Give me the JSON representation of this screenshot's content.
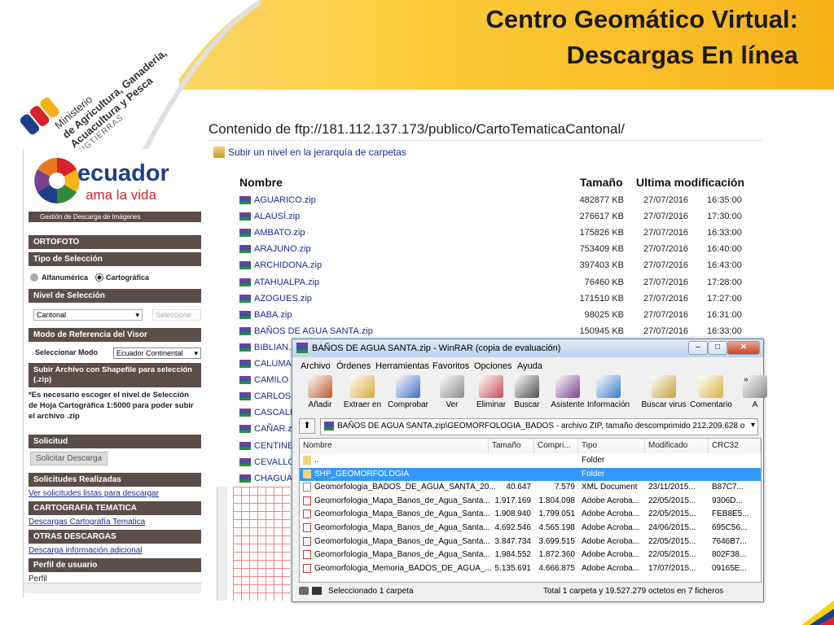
{
  "slide": {
    "title_line1": "Centro Geomático Virtual:",
    "title_line2": "Descargas En línea",
    "ministry": {
      "line1": "Ministerio",
      "line2": "de Agricultura, Ganadería,",
      "line3": "Acuacultura y Pesca",
      "line4": "SIGTIERRAS"
    },
    "colors": {
      "accent_yellow": "#f7b21a",
      "portal_bar": "#5b4d4a",
      "link_blue": "#1a2c8e",
      "selection_blue": "#3399ff"
    }
  },
  "portal": {
    "logo_word": "ecuador",
    "logo_sub": "ama la vida",
    "header_bar": "Gestión de Descarga de Imágenes",
    "ortofoto": "ORTOFOTO",
    "tipo_seleccion": "Tipo de Selección",
    "radio_alfanumerica": "Alfanumérica",
    "radio_cartografica": "Cartográfica",
    "nivel_seleccion": "Nivel de Selección",
    "nivel_value": "Cantonal",
    "nivel_second": "Seleccione",
    "modo_referencia": "Modo de Referencia del Visor",
    "seleccionar_modo": "Seleccionar Modo",
    "modo_value": "Ecuador Continental",
    "subir_archivo": "Subir Archivo con Shapefile para selección (.zip)",
    "nota": "*Es necesario escoger el nivel de Selección de Hoja Cartográfica 1:5000 para poder subir el archivo .zip",
    "solicitud": "Solicitud",
    "solicitar_btn": "Solicitar Descarga",
    "solicitudes_realizadas": "Solicitudes Realizadas",
    "ver_solicitudes": "Ver solicitudes listas para descargar",
    "cartografia_tematica": "CARTOGRAFIA TEMATICA",
    "descargas_cartografia": "Descargas Cartografía Tematica",
    "otras_descargas": "OTRAS DESCARGAS",
    "descarga_info": "Descarga información adicional",
    "perfil_usuario": "Perfil de usuario",
    "perfil": "Perfil"
  },
  "ftp": {
    "heading": "Contenido de ftp://181.112.137.173/publico/CartoTematicaCantonal/",
    "up_link": "Subir un nivel en la jerarquía de carpetas",
    "col_name": "Nombre",
    "col_size": "Tamaño",
    "col_modified": "Ultima modificación",
    "rows": [
      {
        "name": "AGUARICO.zip",
        "size": "482877 KB",
        "date": "27/07/2016",
        "time": "16:35:00"
      },
      {
        "name": "ALAUSÍ.zip",
        "size": "276617 KB",
        "date": "27/07/2016",
        "time": "17:30:00"
      },
      {
        "name": "AMBATO.zip",
        "size": "175826 KB",
        "date": "27/07/2016",
        "time": "16:33:00"
      },
      {
        "name": "ARAJUNO.zip",
        "size": "753409 KB",
        "date": "27/07/2016",
        "time": "16:40:00"
      },
      {
        "name": "ARCHIDONA.zip",
        "size": "397403 KB",
        "date": "27/07/2016",
        "time": "16:43:00"
      },
      {
        "name": "ATAHUALPA.zip",
        "size": "76460 KB",
        "date": "27/07/2016",
        "time": "17:28:00"
      },
      {
        "name": "AZOGUES.zip",
        "size": "171510 KB",
        "date": "27/07/2016",
        "time": "17:27:00"
      },
      {
        "name": "BABA.zip",
        "size": "98025 KB",
        "date": "27/07/2016",
        "time": "16:31:00"
      },
      {
        "name": "BAÑOS DE AGUA SANTA.zip",
        "size": "150945 KB",
        "date": "27/07/2016",
        "time": "16:33:00"
      },
      {
        "name": "BIBLIAN.z",
        "size": "",
        "date": "",
        "time": ""
      },
      {
        "name": "CALUMA.z",
        "size": "",
        "date": "",
        "time": ""
      },
      {
        "name": "CAMILO P",
        "size": "",
        "date": "",
        "time": ""
      },
      {
        "name": "CARLOS J",
        "size": "",
        "date": "",
        "time": ""
      },
      {
        "name": "CASCALES",
        "size": "",
        "date": "",
        "time": ""
      },
      {
        "name": "CAÑAR.zi",
        "size": "",
        "date": "",
        "time": ""
      },
      {
        "name": "CENTINEL",
        "size": "",
        "date": "",
        "time": ""
      },
      {
        "name": "CEVALLOS",
        "size": "",
        "date": "",
        "time": ""
      },
      {
        "name": "CHAGUAF",
        "size": "",
        "date": "",
        "time": ""
      }
    ]
  },
  "winrar": {
    "title": "BAÑOS DE AGUA SANTA.zip - WinRAR (copia de evaluación)",
    "menu": [
      "Archivo",
      "Órdenes",
      "Herramientas",
      "Favoritos",
      "Opciones",
      "Ayuda"
    ],
    "tools": [
      {
        "label": "Añadir",
        "icon": "add-archive-icon",
        "color": "#b55a2a"
      },
      {
        "label": "Extraer en",
        "icon": "extract-icon",
        "color": "#d8a838"
      },
      {
        "label": "Comprobar",
        "icon": "test-icon",
        "color": "#3a6fc2"
      },
      {
        "label": "Ver",
        "icon": "view-icon",
        "color": "#8a8a8a"
      },
      {
        "label": "Eliminar",
        "icon": "delete-icon",
        "color": "#c44a5a"
      },
      {
        "label": "Buscar",
        "icon": "find-icon",
        "color": "#4c4c4c"
      },
      {
        "label": "Asistente",
        "icon": "wizard-icon",
        "color": "#7a3f8f"
      },
      {
        "label": "Información",
        "icon": "info-icon",
        "color": "#3a7ac2"
      },
      {
        "label": "Buscar virus",
        "icon": "virus-scan-icon",
        "color": "#c4a23a"
      },
      {
        "label": "Comentario",
        "icon": "comment-icon",
        "color": "#d8b040"
      },
      {
        "label": "A",
        "icon": "more-icon",
        "color": "#888888"
      }
    ],
    "path": "BAÑOS DE AGUA SANTA.zip\\GEOMORFOLOGIA_BADOS - archivo ZIP, tamaño descomprimido 212.209.628 o",
    "columns": [
      "Nombre",
      "Tamaño",
      "Compri...",
      "Tipo",
      "Modificado",
      "CRC32"
    ],
    "files": [
      {
        "name": "..",
        "size": "",
        "packed": "",
        "type": "Folder",
        "modified": "",
        "crc": "",
        "kind": "folder"
      },
      {
        "name": "SHP_GEOMORFOLOGIA",
        "size": "",
        "packed": "",
        "type": "Folder",
        "modified": "",
        "crc": "",
        "kind": "folder",
        "selected": true
      },
      {
        "name": "Geomorfologia_BADOS_DE_AGUA_SANTA_20...",
        "size": "40.647",
        "packed": "7.579",
        "type": "XML Document",
        "modified": "23/11/2015...",
        "crc": "B87C7...",
        "kind": "xml"
      },
      {
        "name": "Geomorfologia_Mapa_Banos_de_Agua_Santa...",
        "size": "1.917.169",
        "packed": "1.804.098",
        "type": "Adobe Acroba...",
        "modified": "22/05/2015...",
        "crc": "9306D...",
        "kind": "pdf"
      },
      {
        "name": "Geomorfologia_Mapa_Banos_de_Agua_Santa...",
        "size": "1.908.940",
        "packed": "1.799.051",
        "type": "Adobe Acroba...",
        "modified": "22/05/2015...",
        "crc": "FEB8E5...",
        "kind": "pdf"
      },
      {
        "name": "Geomorfologia_Mapa_Banos_de_Agua_Santa...",
        "size": "4.692.546",
        "packed": "4.565.198",
        "type": "Adobe Acroba...",
        "modified": "24/06/2015...",
        "crc": "695C56...",
        "kind": "pdf"
      },
      {
        "name": "Geomorfologia_Mapa_Banos_de_Agua_Santa...",
        "size": "3.847.734",
        "packed": "3.699.515",
        "type": "Adobe Acroba...",
        "modified": "22/05/2015...",
        "crc": "7646B7...",
        "kind": "pdf"
      },
      {
        "name": "Geomorfologia_Mapa_Banos_de_Agua_Santa...",
        "size": "1.984.552",
        "packed": "1.872.360",
        "type": "Adobe Acroba...",
        "modified": "22/05/2015...",
        "crc": "802F38...",
        "kind": "pdf"
      },
      {
        "name": "Geomorfologia_Memoria_BADOS_DE_AGUA_...",
        "size": "5.135.691",
        "packed": "4.666.875",
        "type": "Adobe Acroba...",
        "modified": "17/07/2015...",
        "crc": "09165E...",
        "kind": "pdf"
      }
    ],
    "status_left": "Seleccionado 1 carpeta",
    "status_right": "Total 1 carpeta y 19.527.279 octetos en 7 ficheros"
  }
}
